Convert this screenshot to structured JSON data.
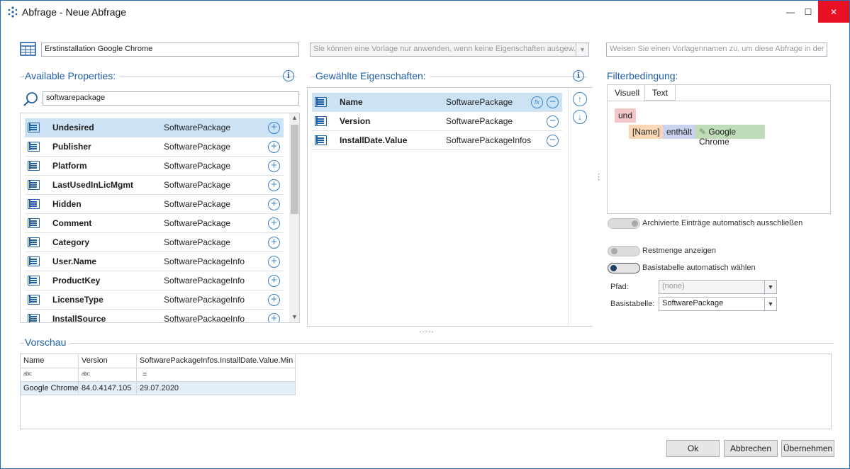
{
  "window": {
    "title": "Abfrage - Neue Abfrage",
    "minimize": "—",
    "maximize": "☐",
    "close": "✕"
  },
  "header": {
    "query_name": "Erstinstallation Google Chrome",
    "template_placeholder": "Sie können eine Vorlage nur anwenden, wenn keine Eigenschaften ausgew...",
    "template_name_placeholder": "Weisen Sie einen Vorlagennamen zu, um diese Abfrage in der Vo"
  },
  "available": {
    "title": "Available Properties:",
    "search_value": "softwarepackage",
    "items": [
      {
        "name": "Undesired",
        "type": "SoftwarePackage",
        "selected": true
      },
      {
        "name": "Publisher",
        "type": "SoftwarePackage"
      },
      {
        "name": "Platform",
        "type": "SoftwarePackage"
      },
      {
        "name": "LastUsedInLicMgmt",
        "type": "SoftwarePackage"
      },
      {
        "name": "Hidden",
        "type": "SoftwarePackage"
      },
      {
        "name": "Comment",
        "type": "SoftwarePackage"
      },
      {
        "name": "Category",
        "type": "SoftwarePackage"
      },
      {
        "name": "User.Name",
        "type": "SoftwarePackageInfo"
      },
      {
        "name": "ProductKey",
        "type": "SoftwarePackageInfo"
      },
      {
        "name": "LicenseType",
        "type": "SoftwarePackageInfo"
      },
      {
        "name": "InstallSource",
        "type": "SoftwarePackageInfo"
      }
    ]
  },
  "selected": {
    "title": "Gewählte Eigenschaften:",
    "items": [
      {
        "name": "Name",
        "type": "SoftwarePackage",
        "selected": true
      },
      {
        "name": "Version",
        "type": "SoftwarePackage"
      },
      {
        "name": "InstallDate.Value",
        "type": "SoftwarePackageInfos"
      }
    ]
  },
  "filter": {
    "title": "Filterbedingung:",
    "tabs": [
      "Visuell",
      "Text"
    ],
    "operator": "und",
    "field": "[Name]",
    "comparison": "enthält",
    "value": "Google Chrome",
    "toggle_archived": "Archivierte Einträge automatisch ausschließen",
    "toggle_rest": "Restmenge anzeigen",
    "toggle_base": "Basistabelle automatisch wählen",
    "path_label": "Pfad:",
    "path_value": "(none)",
    "base_label": "Basistabelle:",
    "base_value": "SoftwarePackage"
  },
  "preview": {
    "title": "Vorschau",
    "columns": [
      "Name",
      "Version",
      "SoftwarePackageInfos.InstallDate.Value.Min"
    ],
    "filter_row": [
      "abc",
      "abc",
      "="
    ],
    "rows": [
      [
        "Google Chrome",
        "84.0.4147.105",
        "29.07.2020"
      ]
    ]
  },
  "buttons": {
    "ok": "Ok",
    "cancel": "Abbrechen",
    "apply": "Übernehmen"
  },
  "colors": {
    "accent": "#1f5fa6",
    "selection": "#cce3f6",
    "chip_operator": "#f4c6c8",
    "chip_field": "#f9d7b4",
    "chip_comparison": "#c9d3f0",
    "chip_value": "#bfdcb9"
  }
}
